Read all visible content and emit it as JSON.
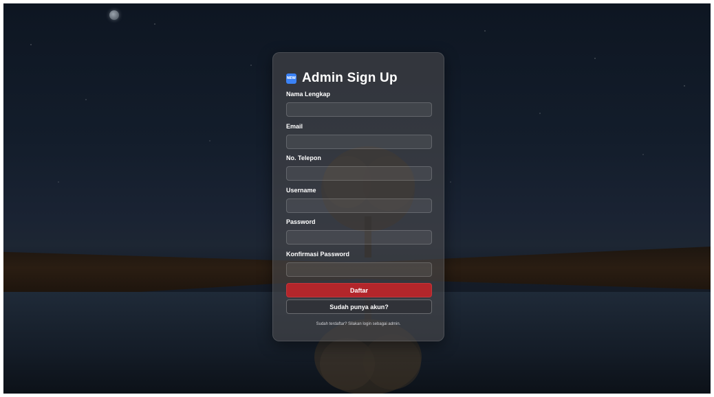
{
  "page": {
    "title": "Admin Sign Up",
    "badge": "NEW",
    "badge_icon": "new-badge-icon",
    "accent_color": "#b3262b",
    "badge_color": "#3b82f6"
  },
  "form": {
    "fields": [
      {
        "label": "Nama Lengkap",
        "value": "",
        "placeholder": ""
      },
      {
        "label": "Email",
        "value": "",
        "placeholder": ""
      },
      {
        "label": "No. Telepon",
        "value": "",
        "placeholder": ""
      },
      {
        "label": "Username",
        "value": "",
        "placeholder": ""
      },
      {
        "label": "Password",
        "value": "",
        "placeholder": ""
      },
      {
        "label": "Konfirmasi Password",
        "value": "",
        "placeholder": ""
      }
    ],
    "submit_label": "Daftar",
    "login_label": "Sudah punya akun?",
    "footnote": "Sudah terdaftar? Silakan login sebagai admin."
  }
}
